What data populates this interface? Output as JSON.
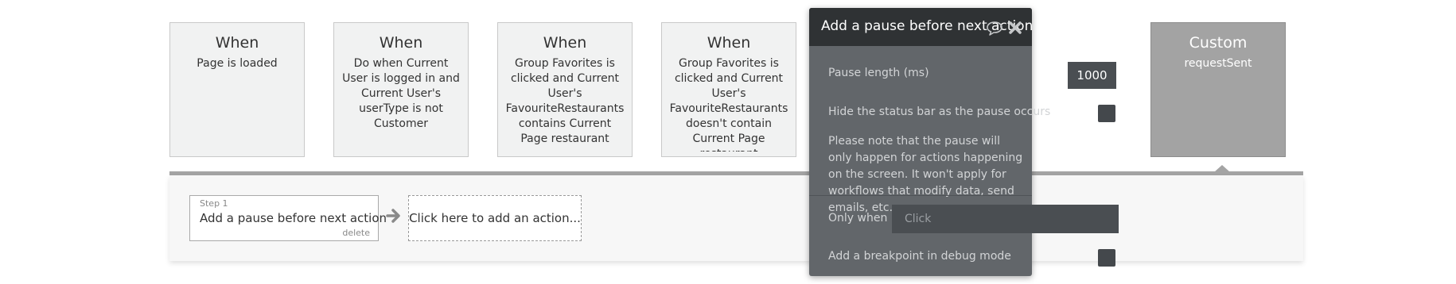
{
  "events": [
    {
      "title": "When",
      "desc": "Page is loaded"
    },
    {
      "title": "When",
      "desc": "Do when Current User is logged in and Current User's userType is not Customer"
    },
    {
      "title": "When",
      "desc": "Group Favorites is clicked and Current User's FavouriteRestaurants contains Current Page restaurant"
    },
    {
      "title": "When",
      "desc": "Group Favorites is clicked and Current User's FavouriteRestaurants doesn't contain Current Page restaurant"
    },
    {
      "title": "Custom",
      "desc": "requestSent"
    }
  ],
  "step": {
    "number_label": "Step 1",
    "label": "Add a pause before next action",
    "delete_label": "delete"
  },
  "add_action_label": "Click here to add an action...",
  "popup": {
    "title": "Add a pause before next action",
    "icons": [
      "comment-icon",
      "close-icon"
    ],
    "pause_length_label": "Pause length (ms)",
    "pause_length_value": "1000",
    "hide_status_label": "Hide the status bar as the pause occurs",
    "hide_status_checked": false,
    "note": "Please note that the pause will only happen for actions happening on the screen. It won't apply for workflows that modify data, send emails, etc.",
    "only_when_label": "Only when",
    "only_when_placeholder": "Click",
    "breakpoint_label": "Add a breakpoint in debug mode",
    "breakpoint_checked": false
  },
  "colors": {
    "card_bg": "#f1f2f2",
    "custom_card_bg": "#a3a3a3",
    "popup_bg": "#62666a",
    "popup_header_bg": "#2f3234"
  }
}
